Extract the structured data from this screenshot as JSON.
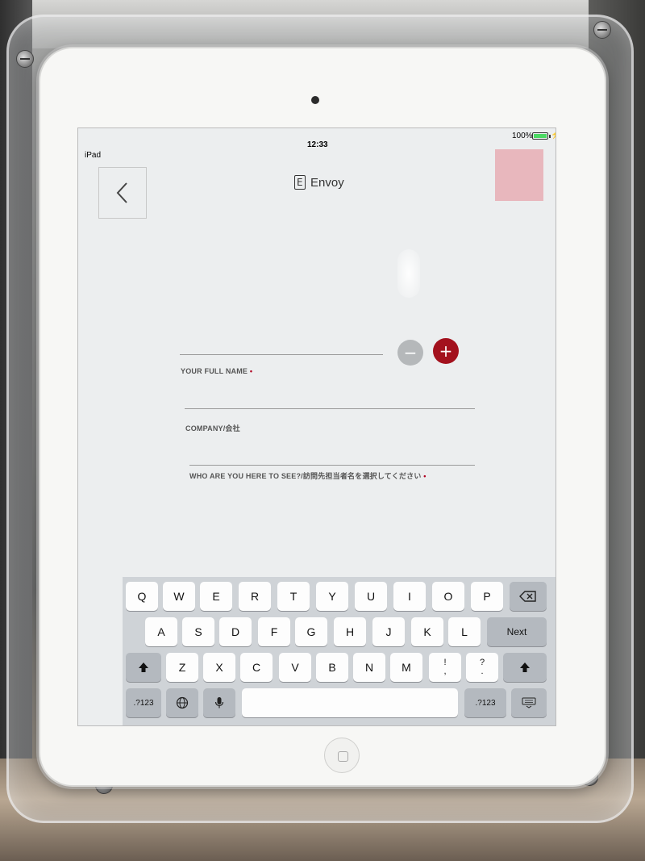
{
  "status": {
    "device": "iPad",
    "time": "12:33",
    "battery": "100%"
  },
  "header": {
    "brand": "Envoy"
  },
  "form": {
    "full_name_label": "YOUR FULL NAME",
    "company_label": "COMPANY/会社",
    "host_label": "WHO ARE YOU HERE TO SEE?/訪問先担当者名を選択してください",
    "required_marker": "•",
    "minus_symbol": "−",
    "plus_symbol": "+"
  },
  "colors": {
    "accent": "#a3111d",
    "swatch": "#e8b7bd",
    "disabled": "#b5b8ba"
  },
  "keyboard": {
    "row1": [
      "Q",
      "W",
      "E",
      "R",
      "T",
      "Y",
      "U",
      "I",
      "O",
      "P"
    ],
    "row2": [
      "A",
      "S",
      "D",
      "F",
      "G",
      "H",
      "J",
      "K",
      "L"
    ],
    "row3": [
      "Z",
      "X",
      "C",
      "V",
      "B",
      "N",
      "M"
    ],
    "punct1_top": "!",
    "punct1_bottom": ",",
    "punct2_top": "?",
    "punct2_bottom": ".",
    "next_label": "Next",
    "numbers_label": ".?123",
    "backspace_icon": "backspace-icon",
    "shift_icon": "shift-icon",
    "globe_icon": "globe-icon",
    "mic_icon": "mic-icon",
    "dismiss_icon": "keyboard-dismiss-icon"
  }
}
